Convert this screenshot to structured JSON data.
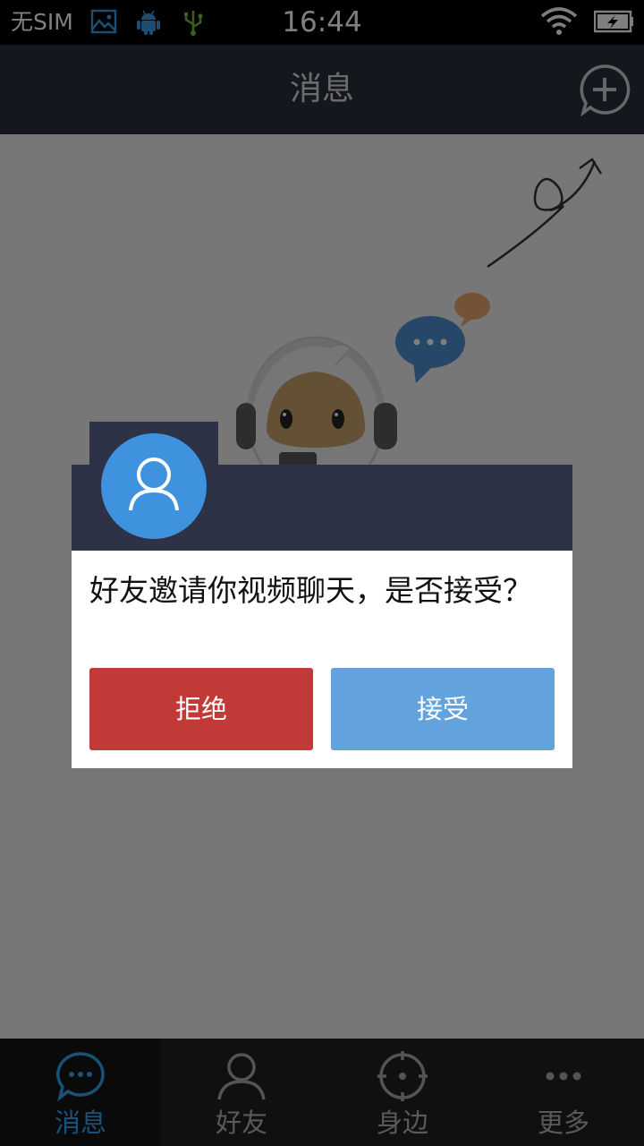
{
  "status_bar": {
    "carrier": "无SIM",
    "time": "16:44",
    "icons": [
      "image-icon",
      "android-icon",
      "usb-icon",
      "wifi-icon",
      "battery-charging-icon"
    ]
  },
  "header": {
    "title": "消息",
    "add_icon": "add-circle-icon"
  },
  "empty_state": {
    "illustration": "robot-with-headset"
  },
  "dialog": {
    "avatar_icon": "user-icon",
    "message": "好友邀请你视频聊天，是否接受？",
    "reject_label": "拒绝",
    "accept_label": "接受"
  },
  "tabs": [
    {
      "label": "消息",
      "icon": "chat-bubble-icon",
      "active": true
    },
    {
      "label": "好友",
      "icon": "person-icon",
      "active": false
    },
    {
      "label": "身边",
      "icon": "target-icon",
      "active": false
    },
    {
      "label": "更多",
      "icon": "more-icon",
      "active": false
    }
  ],
  "colors": {
    "header_bg": "#2b2f3e",
    "active_tab": "#36a3ef",
    "reject": "#c13a37",
    "accept": "#62a3de",
    "avatar": "#3f92de"
  }
}
